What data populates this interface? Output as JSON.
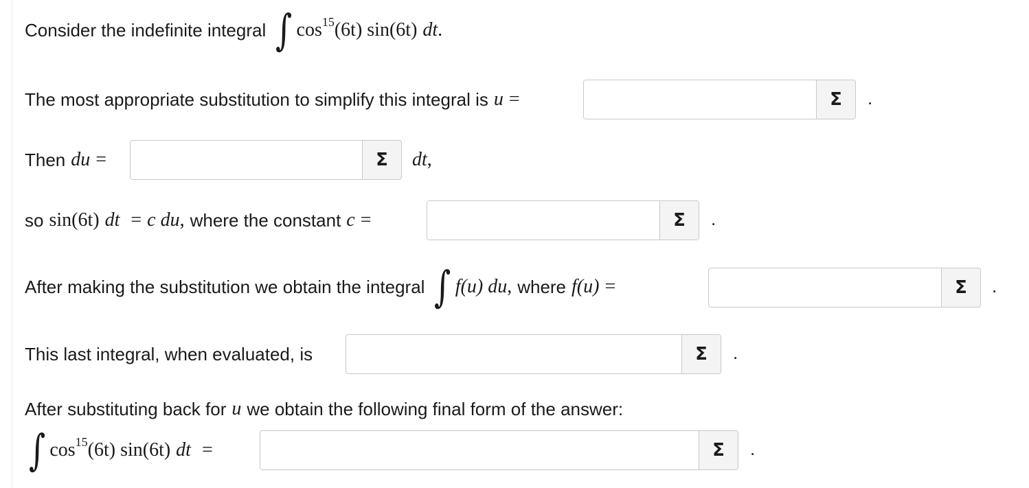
{
  "q1": {
    "text": "Consider the indefinite integral",
    "integral": "∫",
    "cos": "cos",
    "exp": "15",
    "arg1": "(6t) sin(6t)",
    "dt": "dt",
    "end": "."
  },
  "q2": {
    "text": "The most appropriate substitution to simplify this integral is",
    "var": "u",
    "eq": "="
  },
  "q3": {
    "text": "Then",
    "du": "du",
    "eq": "=",
    "after": "dt",
    "comma": ","
  },
  "q4": {
    "so": "so",
    "lhs": "sin(6t)",
    "lhs_dt": "dt",
    "eq": "=",
    "c_du": "c du",
    "comma": ",",
    "text": "where the constant",
    "c": "c",
    "eq2": "="
  },
  "q5": {
    "text": "After making the substitution we obtain the integral",
    "integral": "∫",
    "fu": "f(u) du",
    "comma": ",",
    "where": "where",
    "fu2": "f(u)",
    "eq": "="
  },
  "q6": {
    "text": "This last integral, when evaluated, is"
  },
  "q7": {
    "text1": "After substituting back for",
    "var": "u",
    "text2": "we obtain the following final form of the answer:"
  },
  "q8": {
    "integral": "∫",
    "cos": "cos",
    "exp": "15",
    "arg": "(6t) sin(6t)",
    "dt": "dt",
    "eq": "="
  },
  "sigma": "Σ",
  "period": "."
}
